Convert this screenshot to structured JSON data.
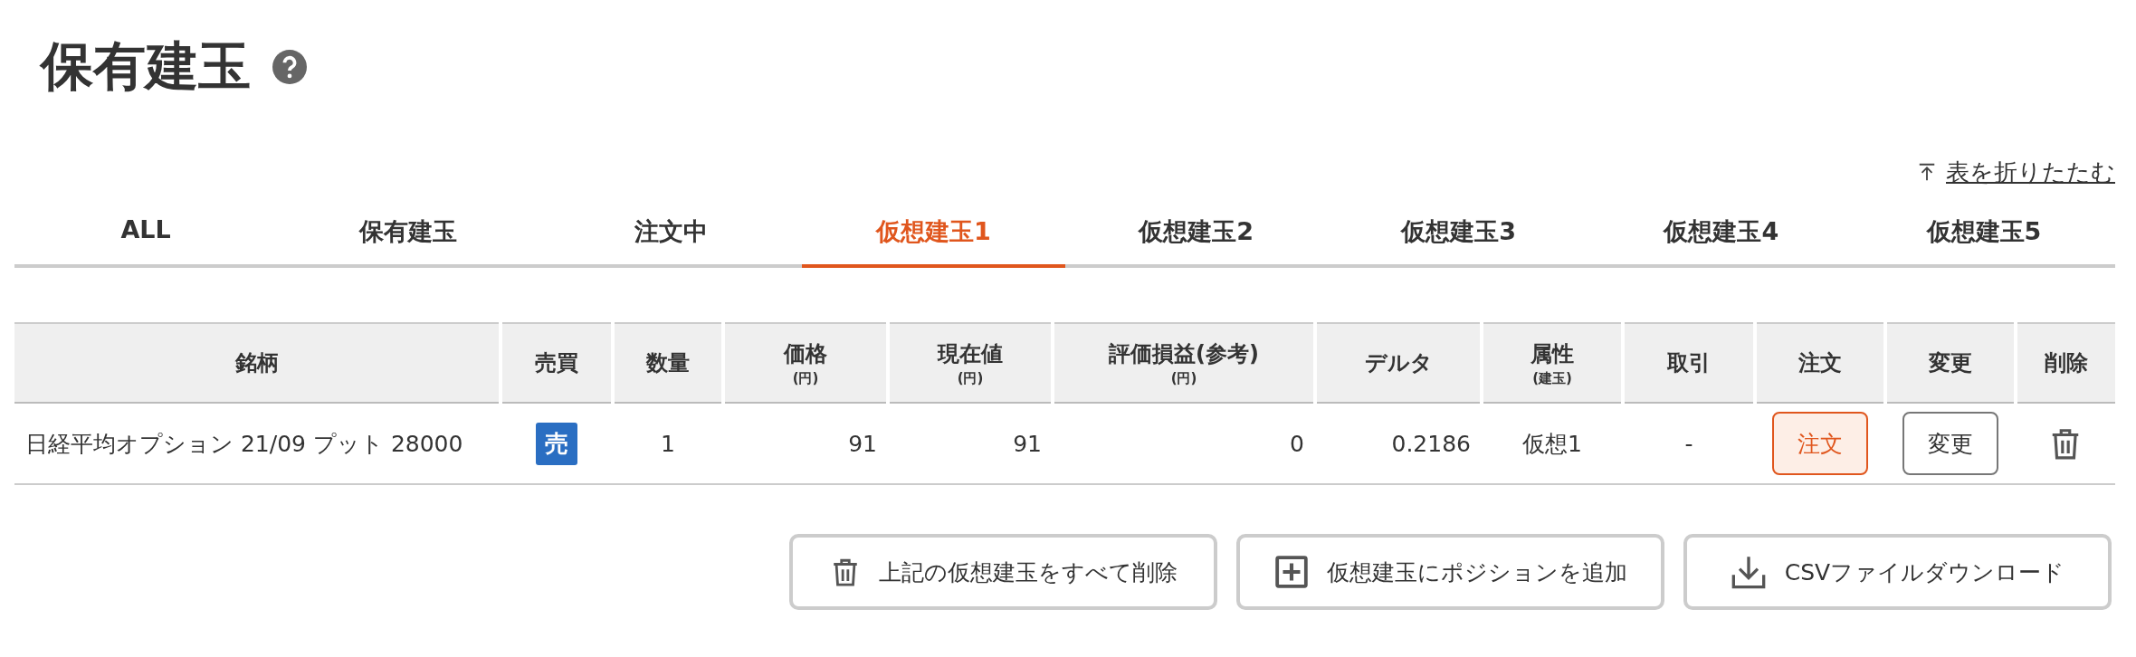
{
  "title": "保有建玉",
  "collapse_link": "表を折りたたむ",
  "tabs": [
    {
      "label": "ALL",
      "selected": false
    },
    {
      "label": "保有建玉",
      "selected": false
    },
    {
      "label": "注文中",
      "selected": false
    },
    {
      "label": "仮想建玉1",
      "selected": true
    },
    {
      "label": "仮想建玉2",
      "selected": false
    },
    {
      "label": "仮想建玉3",
      "selected": false
    },
    {
      "label": "仮想建玉4",
      "selected": false
    },
    {
      "label": "仮想建玉5",
      "selected": false
    }
  ],
  "table": {
    "columns": [
      {
        "label": "銘柄"
      },
      {
        "label": "売買"
      },
      {
        "label": "数量"
      },
      {
        "label": "価格",
        "unit": "(円)"
      },
      {
        "label": "現在値",
        "unit": "(円)"
      },
      {
        "label": "評価損益(参考)",
        "unit": "(円)"
      },
      {
        "label": "デルタ"
      },
      {
        "label": "属性",
        "unit": "(建玉)"
      },
      {
        "label": "取引"
      },
      {
        "label": "注文"
      },
      {
        "label": "変更"
      },
      {
        "label": "削除"
      }
    ],
    "rows": [
      {
        "name": "日経平均オプション 21/09 プット 28000",
        "side": "売",
        "quantity": "1",
        "price": "91",
        "current": "91",
        "pl": "0",
        "delta": "0.2186",
        "attribute": "仮想1",
        "trade": "-",
        "order_button": "注文",
        "change_button": "変更"
      }
    ]
  },
  "actions": [
    {
      "kind": "trash",
      "label": "上記の仮想建玉をすべて削除"
    },
    {
      "kind": "plus",
      "label": "仮想建玉にポジションを追加"
    },
    {
      "kind": "download",
      "label": "CSVファイルダウンロード"
    }
  ]
}
